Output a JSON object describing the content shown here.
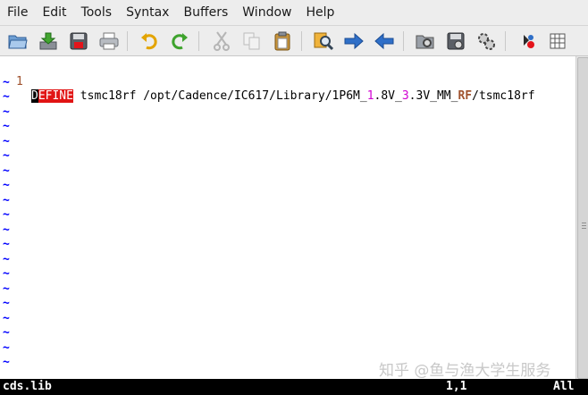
{
  "menu": [
    "File",
    "Edit",
    "Tools",
    "Syntax",
    "Buffers",
    "Window",
    "Help"
  ],
  "toolbar": {
    "icons": [
      "open-icon",
      "save-icon",
      "save-all-icon",
      "print-icon",
      "undo-icon",
      "redo-icon",
      "cut-icon",
      "copy-icon",
      "paste-icon",
      "find-replace-icon",
      "forward-icon",
      "back-icon",
      "session-icon",
      "make-icon",
      "build-tags-icon",
      "shell-icon",
      "table-icon"
    ]
  },
  "editor": {
    "line1": {
      "number": "1",
      "cursor_char": "D",
      "keyword_rest": "EFINE",
      "t1": " tsmc18rf /opt/Cadence/IC617/Library/1P6M_",
      "n1": "1",
      "t2": ".8V_",
      "n2": "3",
      "t3": ".3V_MM_",
      "rf": "RF",
      "t4": "/tsmc18rf"
    },
    "tilde": "~"
  },
  "status": {
    "filename": "cds.lib",
    "position": "1,1",
    "scroll": "All"
  },
  "watermark": "知乎 @鱼与渔大学生服务",
  "colors": {
    "keyword_bg": "#e11414",
    "number": "#d100d1",
    "special": "#a0522d",
    "tilde": "#0000ff"
  }
}
